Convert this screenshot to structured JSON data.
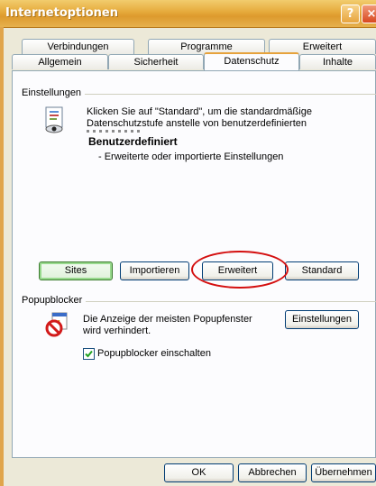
{
  "window": {
    "title": "Internetoptionen",
    "help_label": "?",
    "close_label": "×"
  },
  "tabs": {
    "row1": [
      "Verbindungen",
      "Programme",
      "Erweitert"
    ],
    "row2": [
      "Allgemein",
      "Sicherheit",
      "Datenschutz",
      "Inhalte"
    ],
    "active": "Datenschutz"
  },
  "settings": {
    "group_label": "Einstellungen",
    "description_line1": "Klicken Sie auf \"Standard\", um die standardmäßige",
    "description_line2": "Datenschutzstufe anstelle von benutzerdefinierten",
    "level_title": "Benutzerdefiniert",
    "level_detail": "- Erweiterte oder importierte Einstellungen"
  },
  "settings_buttons": {
    "sites": "Sites",
    "import": "Importieren",
    "advanced": "Erweitert",
    "default": "Standard"
  },
  "popup": {
    "group_label": "Popupblocker",
    "description_line1": "Die Anzeige der meisten Popupfenster",
    "description_line2": "wird verhindert.",
    "settings_button": "Einstellungen",
    "checkbox_label": "Popupblocker einschalten",
    "checkbox_checked": true
  },
  "dialog_buttons": {
    "ok": "OK",
    "cancel": "Abbrechen",
    "apply": "Übernehmen"
  },
  "colors": {
    "title_bar": "#e5a93a",
    "annotation_circle": "#d40f0f"
  }
}
